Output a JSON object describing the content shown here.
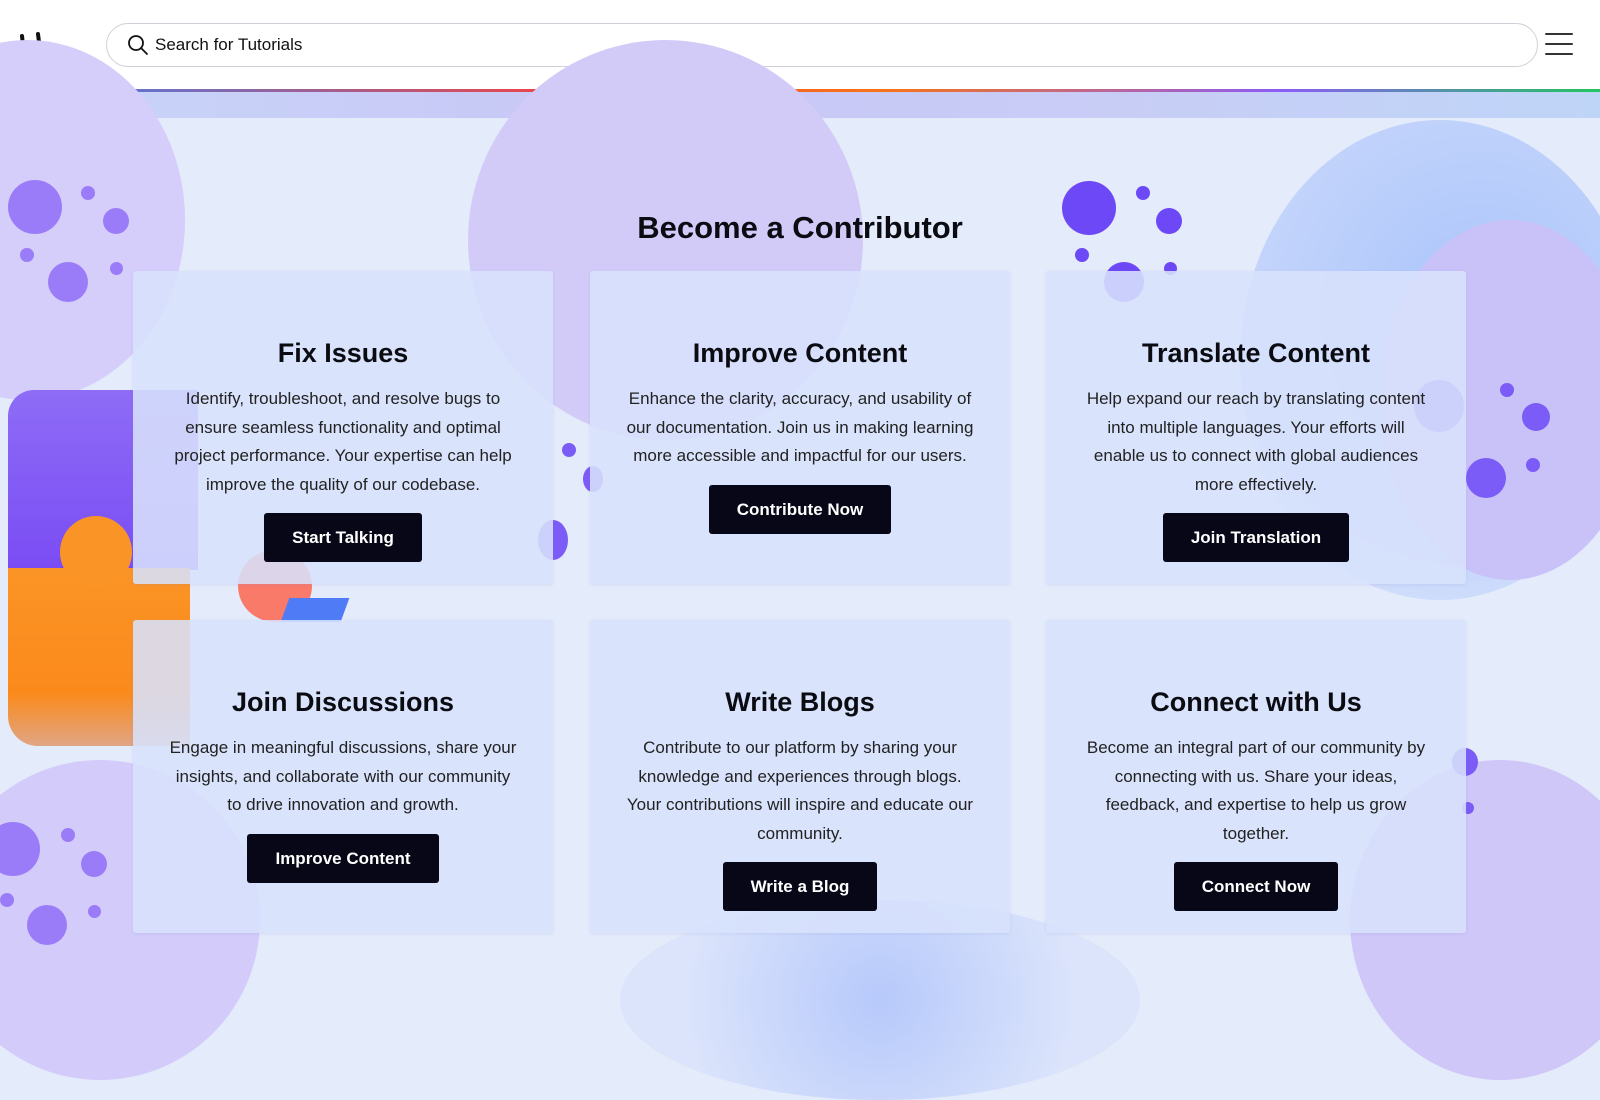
{
  "header": {
    "logo_text": "LL",
    "search_placeholder": "Search for Tutorials",
    "icons": [
      "logo-icon",
      "search-icon",
      "hamburger-menu-icon"
    ]
  },
  "main": {
    "title": "Become a Contributor",
    "cards": [
      {
        "title": "Fix Issues",
        "description": "Identify, troubleshoot, and resolve bugs to ensure seamless functionality and optimal project performance. Your expertise can help improve the quality of our codebase.",
        "button": "Start Talking"
      },
      {
        "title": "Improve Content",
        "description": "Enhance the clarity, accuracy, and usability of our documentation. Join us in making learning more accessible and impactful for our users.",
        "button": "Contribute Now"
      },
      {
        "title": "Translate Content",
        "description": "Help expand our reach by translating content into multiple languages. Your efforts will enable us to connect with global audiences more effectively.",
        "button": "Join Translation"
      },
      {
        "title": "Join Discussions",
        "description": "Engage in meaningful discussions, share your insights, and collaborate with our community to drive innovation and growth.",
        "button": "Improve Content"
      },
      {
        "title": "Write Blogs",
        "description": "Contribute to our platform by sharing your knowledge and experiences through blogs. Your contributions will inspire and educate our community.",
        "button": "Write a Blog"
      },
      {
        "title": "Connect with Us",
        "description": "Become an integral part of our community by connecting with us. Share your ideas, feedback, and expertise to help us grow together.",
        "button": "Connect Now"
      }
    ]
  },
  "colors": {
    "button_bg": "#070717",
    "accent_purple": "#7c5cf6",
    "background": "#e4ebfb"
  }
}
